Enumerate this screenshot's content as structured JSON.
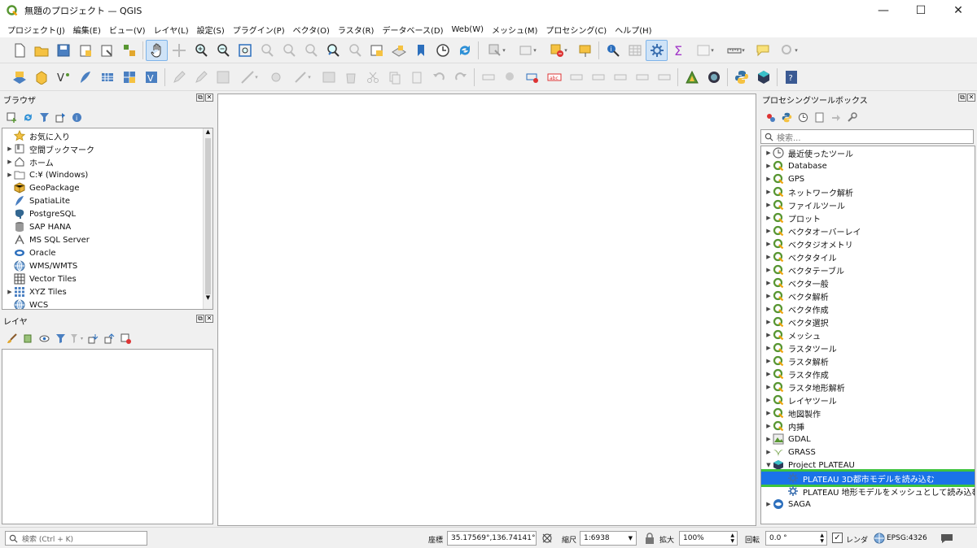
{
  "window": {
    "title": "無題のプロジェクト — QGIS",
    "minimize": "—",
    "maximize": "☐",
    "close": "✕"
  },
  "menu": [
    "プロジェクト(J)",
    "編集(E)",
    "ビュー(V)",
    "レイヤ(L)",
    "設定(S)",
    "プラグイン(P)",
    "ベクタ(O)",
    "ラスタ(R)",
    "データベース(D)",
    "Web(W)",
    "メッシュ(M)",
    "プロセシング(C)",
    "ヘルプ(H)"
  ],
  "browser": {
    "title": "ブラウザ",
    "items": [
      {
        "label": "お気に入り",
        "icon": "star-icon",
        "expand": false
      },
      {
        "label": "空間ブックマーク",
        "icon": "bookmark-icon",
        "expand": true
      },
      {
        "label": "ホーム",
        "icon": "home-icon",
        "expand": true
      },
      {
        "label": "C:¥ (Windows)",
        "icon": "folder-icon",
        "expand": true
      },
      {
        "label": "GeoPackage",
        "icon": "geopackage-icon",
        "expand": false
      },
      {
        "label": "SpatiaLite",
        "icon": "feather-icon",
        "expand": false
      },
      {
        "label": "PostgreSQL",
        "icon": "elephant-icon",
        "expand": false
      },
      {
        "label": "SAP HANA",
        "icon": "database-icon",
        "expand": false
      },
      {
        "label": "MS SQL Server",
        "icon": "mssql-icon",
        "expand": false
      },
      {
        "label": "Oracle",
        "icon": "oracle-icon",
        "expand": false
      },
      {
        "label": "WMS/WMTS",
        "icon": "globe-icon",
        "expand": false
      },
      {
        "label": "Vector Tiles",
        "icon": "grid-icon",
        "expand": false
      },
      {
        "label": "XYZ Tiles",
        "icon": "tiles-icon",
        "expand": true
      },
      {
        "label": "WCS",
        "icon": "globe-icon",
        "expand": false
      }
    ]
  },
  "layers": {
    "title": "レイヤ"
  },
  "toolbox": {
    "title": "プロセシングツールボックス",
    "search_placeholder": "検索...",
    "items": [
      {
        "label": "最近使ったツール",
        "icon": "clock-icon",
        "expand": "right",
        "indent": 0
      },
      {
        "label": "Database",
        "icon": "qgis-icon",
        "expand": "right",
        "indent": 0
      },
      {
        "label": "GPS",
        "icon": "qgis-icon",
        "expand": "right",
        "indent": 0
      },
      {
        "label": "ネットワーク解析",
        "icon": "qgis-icon",
        "expand": "right",
        "indent": 0
      },
      {
        "label": "ファイルツール",
        "icon": "qgis-icon",
        "expand": "right",
        "indent": 0
      },
      {
        "label": "プロット",
        "icon": "qgis-icon",
        "expand": "right",
        "indent": 0
      },
      {
        "label": "ベクタオーバーレイ",
        "icon": "qgis-icon",
        "expand": "right",
        "indent": 0
      },
      {
        "label": "ベクタジオメトリ",
        "icon": "qgis-icon",
        "expand": "right",
        "indent": 0
      },
      {
        "label": "ベクタタイル",
        "icon": "qgis-icon",
        "expand": "right",
        "indent": 0
      },
      {
        "label": "ベクタテーブル",
        "icon": "qgis-icon",
        "expand": "right",
        "indent": 0
      },
      {
        "label": "ベクタ一般",
        "icon": "qgis-icon",
        "expand": "right",
        "indent": 0
      },
      {
        "label": "ベクタ解析",
        "icon": "qgis-icon",
        "expand": "right",
        "indent": 0
      },
      {
        "label": "ベクタ作成",
        "icon": "qgis-icon",
        "expand": "right",
        "indent": 0
      },
      {
        "label": "ベクタ選択",
        "icon": "qgis-icon",
        "expand": "right",
        "indent": 0
      },
      {
        "label": "メッシュ",
        "icon": "qgis-icon",
        "expand": "right",
        "indent": 0
      },
      {
        "label": "ラスタツール",
        "icon": "qgis-icon",
        "expand": "right",
        "indent": 0
      },
      {
        "label": "ラスタ解析",
        "icon": "qgis-icon",
        "expand": "right",
        "indent": 0
      },
      {
        "label": "ラスタ作成",
        "icon": "qgis-icon",
        "expand": "right",
        "indent": 0
      },
      {
        "label": "ラスタ地形解析",
        "icon": "qgis-icon",
        "expand": "right",
        "indent": 0
      },
      {
        "label": "レイヤツール",
        "icon": "qgis-icon",
        "expand": "right",
        "indent": 0
      },
      {
        "label": "地図製作",
        "icon": "qgis-icon",
        "expand": "right",
        "indent": 0
      },
      {
        "label": "内挿",
        "icon": "qgis-icon",
        "expand": "right",
        "indent": 0
      },
      {
        "label": "GDAL",
        "icon": "gdal-icon",
        "expand": "right",
        "indent": 0
      },
      {
        "label": "GRASS",
        "icon": "grass-icon",
        "expand": "right",
        "indent": 0
      },
      {
        "label": "Project PLATEAU",
        "icon": "plateau-icon",
        "expand": "down",
        "indent": 0
      },
      {
        "label": "PLATEAU 3D都市モデルを読み込む",
        "icon": "gear-icon",
        "expand": "",
        "indent": 1,
        "selected": true
      },
      {
        "label": "PLATEAU 地形モデルをメッシュとして読み込む",
        "icon": "gear-icon",
        "expand": "",
        "indent": 1
      },
      {
        "label": "SAGA",
        "icon": "saga-icon",
        "expand": "right",
        "indent": 0
      }
    ]
  },
  "statusbar": {
    "search_placeholder": "検索 (Ctrl + K)",
    "coord_label": "座標",
    "coord_value": "35.17569°,136.74141°",
    "scale_label": "縮尺",
    "scale_value": "1:6938",
    "zoom_label": "拡大",
    "zoom_value": "100%",
    "rotation_label": "回転",
    "rotation_value": "0.0 °",
    "render_label": "レンダ",
    "crs_label": "EPSG:4326"
  },
  "colors": {
    "selection": "#1a73e8",
    "highlight_border": "#3ec43e",
    "qgis_green": "#589632"
  }
}
